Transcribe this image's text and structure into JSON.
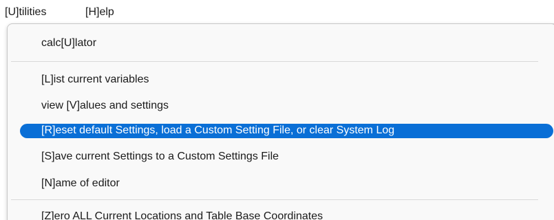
{
  "menubar": {
    "items": [
      {
        "label": "[U]tilities"
      },
      {
        "label": "[H]elp"
      }
    ]
  },
  "dropdown": {
    "items": [
      {
        "label": "calc[U]lator"
      },
      {
        "label": "[L]ist current variables"
      },
      {
        "label": "view [V]alues and settings"
      },
      {
        "label": "[R]eset default Settings, load a Custom Setting File, or clear System Log",
        "selected": true
      },
      {
        "label": "[S]ave current Settings to a Custom Settings File"
      },
      {
        "label": "[N]ame of editor"
      },
      {
        "label": "[Z]ero ALL Current Locations and Table Base Coordinates"
      }
    ]
  },
  "colors": {
    "highlight": "#0a6fd6",
    "highlight_text": "#ffffff",
    "menu_background": "#f9f9f9"
  }
}
